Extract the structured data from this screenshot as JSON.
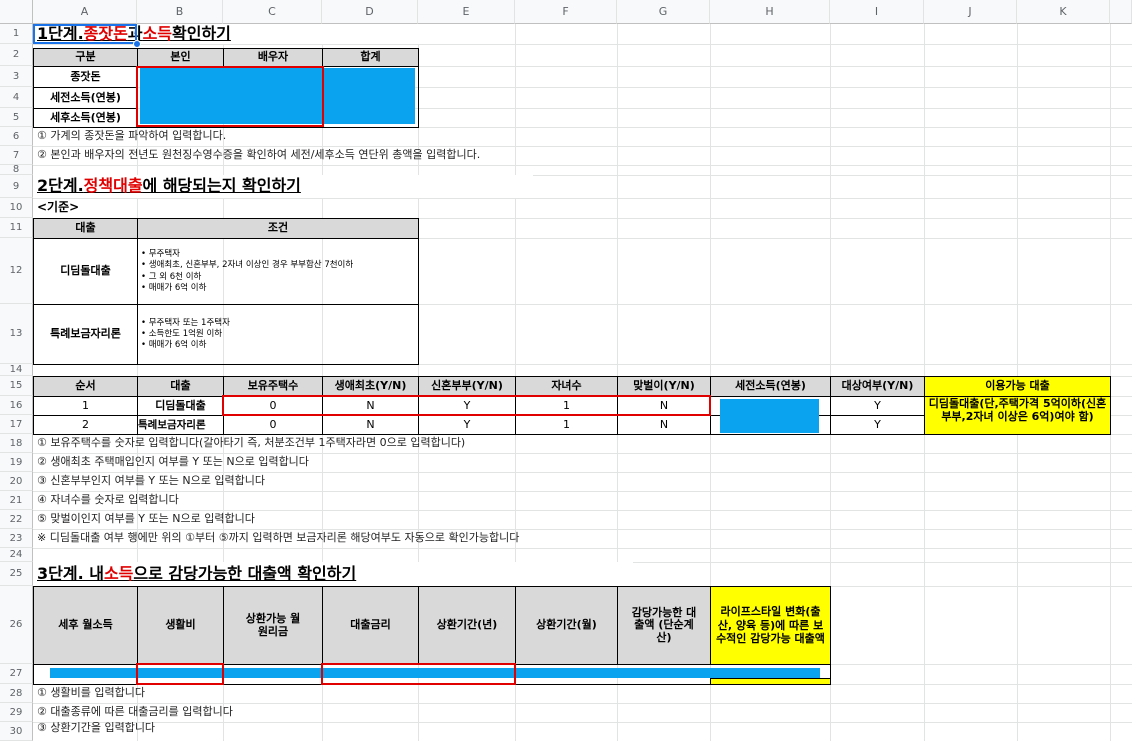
{
  "columns": [
    "A",
    "B",
    "C",
    "D",
    "E",
    "F",
    "G",
    "H",
    "I",
    "J",
    "K"
  ],
  "rows": [
    "1",
    "2",
    "3",
    "4",
    "5",
    "6",
    "7",
    "8",
    "9",
    "10",
    "11",
    "12",
    "13",
    "14",
    "15",
    "16",
    "17",
    "18",
    "19",
    "20",
    "21",
    "22",
    "23",
    "24",
    "25",
    "26",
    "27",
    "28",
    "29",
    "30"
  ],
  "step1": {
    "title_a": "1단계. ",
    "title_b": "종잣돈",
    "title_c": "과 ",
    "title_d": "소득",
    "title_e": " 확인하기",
    "headers": [
      "구분",
      "본인",
      "배우자",
      "합계"
    ],
    "row_labels": [
      "종잣돈",
      "세전소득(연봉)",
      "세후소득(연봉)"
    ],
    "notes": [
      "① 가계의 종잣돈을 파악하여 입력합니다.",
      "② 본인과 배우자의 전년도 원천징수영수증을 확인하여 세전/세후소득 연단위 총액을 입력합니다."
    ]
  },
  "step2": {
    "title_a": "2단계. ",
    "title_b": "정책대출",
    "title_c": "에 해당되는지 확인하기",
    "criteria_label": "<기준>",
    "criteria_headers": [
      "대출",
      "조건"
    ],
    "criteria": [
      {
        "loan": "디딤돌대출",
        "cond": "• 무주택자\n• 생애최초, 신혼부부, 2자녀 이상인 경우 부부합산 7천이하\n• 그 외 6천 이하\n• 매매가 6억 이하"
      },
      {
        "loan": "특례보금자리론",
        "cond": "• 무주택자 또는 1주택자\n• 소득한도 1억원 이하\n• 매매가 6억 이하"
      }
    ],
    "table_headers": [
      "순서",
      "대출",
      "보유주택수",
      "생애최초(Y/N)",
      "신혼부부(Y/N)",
      "자녀수",
      "맞벌이(Y/N)",
      "세전소득(연봉)",
      "대상여부(Y/N)",
      "이용가능 대출"
    ],
    "table_rows": [
      {
        "no": "1",
        "loan": "디딤돌대출",
        "houses": "0",
        "first": "N",
        "newly": "Y",
        "kids": "1",
        "dual": "N",
        "target": "Y"
      },
      {
        "no": "2",
        "loan": "특례보금자리론",
        "houses": "0",
        "first": "N",
        "newly": "Y",
        "kids": "1",
        "dual": "N",
        "target": "Y"
      }
    ],
    "available_loan": "디딤돌대출(단,주택가격 5억이하(신혼부부,2자녀 이상은 6억)여야 함)",
    "notes": [
      "① 보유주택수를 숫자로 입력합니다(갈아타기 즉, 처분조건부 1주택자라면 0으로 입력합니다)",
      "② 생애최초 주택매입인지 여부를 Y 또는 N으로 입력합니다",
      "③ 신혼부부인지 여부를 Y 또는 N으로 입력합니다",
      "④ 자녀수를 숫자로 입력합니다",
      "⑤ 맞벌이인지 여부를 Y 또는 N으로 입력합니다",
      "※ 디딤돌대출 여부 행에만 위의 ①부터 ⑤까지 입력하면 보금자리론 해당여부도 자동으로 확인가능합니다"
    ]
  },
  "step3": {
    "title_a": "3단계. 내 ",
    "title_b": "소득",
    "title_c": "으로 감당가능한 대출액 확인하기",
    "headers": [
      "세후 월소득",
      "생활비",
      "상환가능 월원리금",
      "대출금리",
      "상환기간(년)",
      "상환기간(월)",
      "감당가능한 대출액 (단순계산)",
      "라이프스타일 변화(출산, 양육 등)에 따른 보수적인 감당가능 대출액"
    ],
    "notes": [
      "① 생활비를 입력합니다",
      "② 대출종류에 따른 대출금리를 입력합니다",
      "③ 상환기간을 입력합니다"
    ]
  },
  "colors": {
    "header_gray": "#d9d9d9",
    "highlight_blue": "#0aa3f0",
    "input_red": "#e00000",
    "yellow": "#ffff00",
    "selection": "#1a73e8"
  }
}
